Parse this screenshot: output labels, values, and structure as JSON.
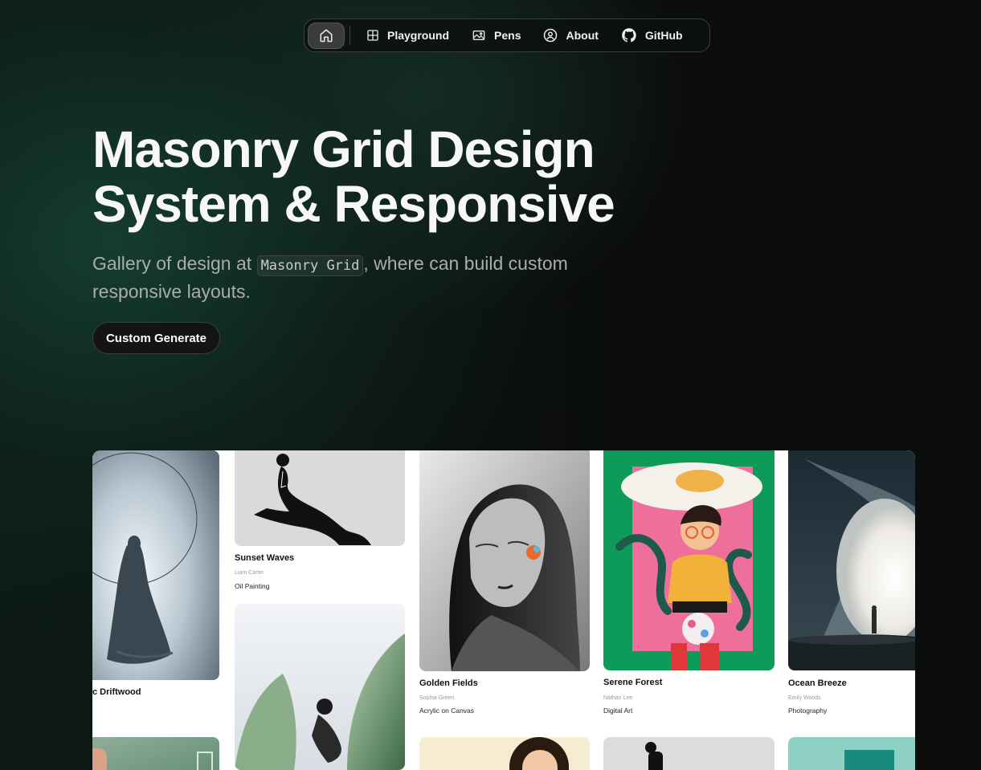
{
  "nav": {
    "home_icon": "home-icon",
    "items": [
      {
        "label": "Playground",
        "icon": "grid-icon"
      },
      {
        "label": "Pens",
        "icon": "image-icon"
      },
      {
        "label": "About",
        "icon": "user-circle-icon"
      },
      {
        "label": "GitHub",
        "icon": "github-icon"
      }
    ]
  },
  "hero": {
    "title_line1": "Masonry Grid Design",
    "title_line2": "System & Responsive",
    "subtitle_before": "Gallery of design at ",
    "subtitle_code": "Masonry Grid",
    "subtitle_after": ", where can build custom responsive layouts.",
    "cta_label": "Custom Generate"
  },
  "gallery": {
    "cards": [
      {
        "title": "c Driftwood",
        "author": "",
        "medium": ""
      },
      {
        "title": "Sunset Waves",
        "author": "Liam Carter",
        "medium": "Oil Painting"
      },
      {
        "title": "Golden Fields",
        "author": "Sophia Green",
        "medium": "Acrylic on Canvas"
      },
      {
        "title": "Serene Forest",
        "author": "Nathan Lee",
        "medium": "Digital Art"
      },
      {
        "title": "Ocean Breeze",
        "author": "Emily Woods",
        "medium": "Photography"
      }
    ]
  },
  "colors": {
    "background": "#0b0c0c",
    "glow": "#164434",
    "card_bg": "#ffffff",
    "serene_green": "#0e9a58",
    "serene_pink": "#ee6f9c"
  }
}
